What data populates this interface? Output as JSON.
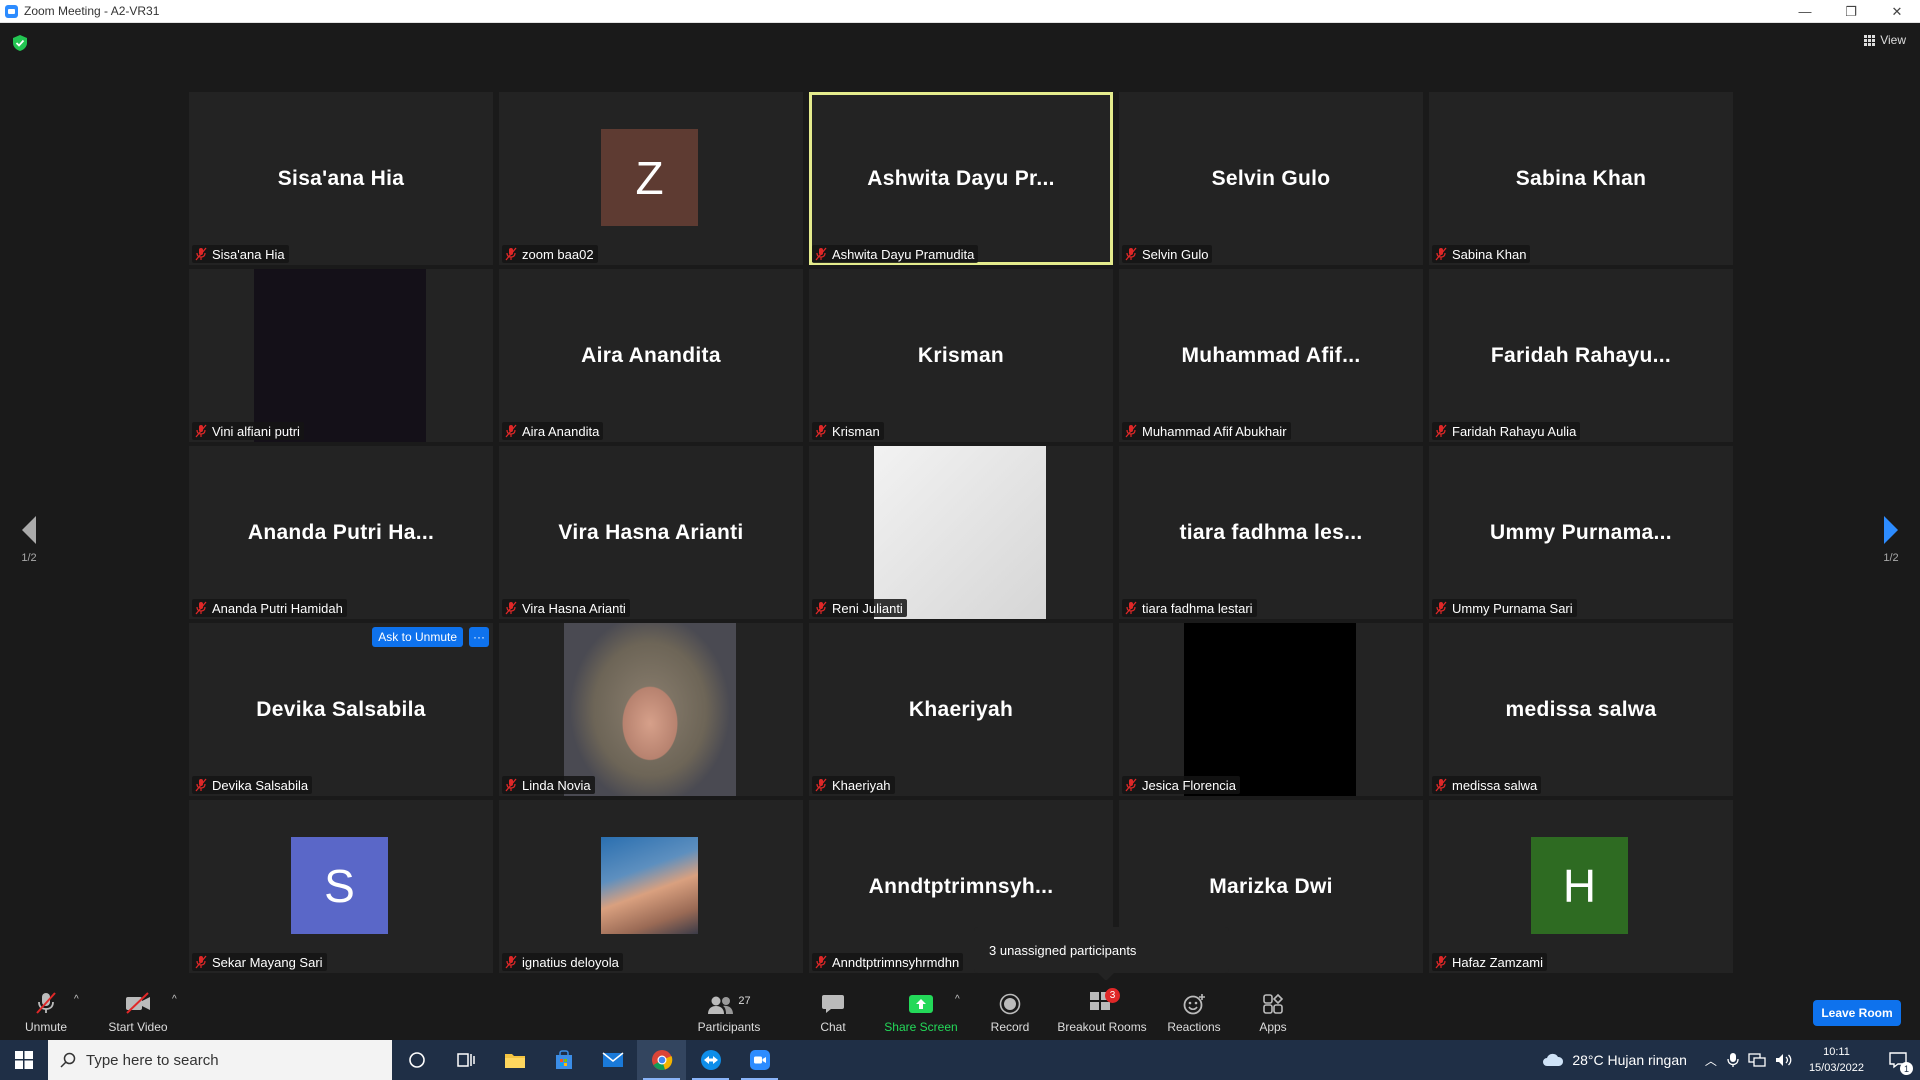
{
  "window": {
    "title": "Zoom Meeting - A2-VR31",
    "minimize": "—",
    "restore": "❐",
    "close": "✕"
  },
  "header": {
    "view_label": "View"
  },
  "pager": {
    "prev_label": "1/2",
    "next_label": "1/2"
  },
  "tiles": [
    {
      "display": "Sisa'ana Hia",
      "label": "Sisa'ana Hia"
    },
    {
      "avatar_letter": "Z",
      "avatar_color": "#5e3b32",
      "label": "zoom baa02"
    },
    {
      "display": "Ashwita Dayu Pr...",
      "label": "Ashwita Dayu Pramudita",
      "active": true
    },
    {
      "display": "Selvin Gulo",
      "label": "Selvin Gulo"
    },
    {
      "display": "Sabina Khan",
      "label": "Sabina Khan"
    },
    {
      "video": "dark",
      "label": "Vini alfiani putri"
    },
    {
      "display": "Aira Anandita",
      "label": "Aira Anandita"
    },
    {
      "display": "Krisman",
      "label": "Krisman"
    },
    {
      "display": "Muhammad  Afif...",
      "label": "Muhammad Afif Abukhair"
    },
    {
      "display": "Faridah  Rahayu...",
      "label": "Faridah Rahayu Aulia"
    },
    {
      "display": "Ananda  Putri  Ha...",
      "label": "Ananda Putri Hamidah"
    },
    {
      "display": "Vira Hasna Arianti",
      "label": "Vira Hasna Arianti"
    },
    {
      "video": "light",
      "label": "Reni Julianti"
    },
    {
      "display": "tiara  fadhma  les...",
      "label": "tiara fadhma lestari"
    },
    {
      "display": "Ummy  Purnama...",
      "label": "Ummy Purnama Sari"
    },
    {
      "display": "Devika Salsabila",
      "label": "Devika Salsabila",
      "ask_unmute": "Ask to Unmute",
      "more": "···"
    },
    {
      "video": "photo",
      "label": "Linda Novia"
    },
    {
      "display": "Khaeriyah",
      "label": "Khaeriyah"
    },
    {
      "video": "black",
      "label": "Jesica Florencia"
    },
    {
      "display": "medissa salwa",
      "label": "medissa salwa"
    },
    {
      "avatar_letter": "S",
      "avatar_color": "#5a67c8",
      "label": "Sekar Mayang Sari"
    },
    {
      "video": "thumb",
      "label": "ignatius deloyola"
    },
    {
      "display": "Anndtptrimnsyh...",
      "label": "Anndtptrimnsyhrmdhn"
    },
    {
      "display": "Marizka Dwi",
      "label": ""
    },
    {
      "avatar_letter": "H",
      "avatar_color": "#2e6b22",
      "label": "Hafaz Zamzami"
    }
  ],
  "tooltip": {
    "text": "3 unassigned participants"
  },
  "toolbar": {
    "unmute": "Unmute",
    "start_video": "Start Video",
    "participants": "Participants",
    "participants_count": "27",
    "chat": "Chat",
    "share_screen": "Share Screen",
    "record": "Record",
    "breakout_rooms": "Breakout Rooms",
    "breakout_badge": "3",
    "reactions": "Reactions",
    "apps": "Apps",
    "leave": "Leave Room"
  },
  "colors": {
    "accent": "#0e72ed",
    "share_green": "#23d959",
    "active_border": "#e5ec8d",
    "mute_red": "#e02828"
  },
  "taskbar": {
    "search_placeholder": "Type here to search",
    "weather": "28°C  Hujan ringan",
    "time": "10:11",
    "date": "15/03/2022",
    "notification_count": "1"
  }
}
